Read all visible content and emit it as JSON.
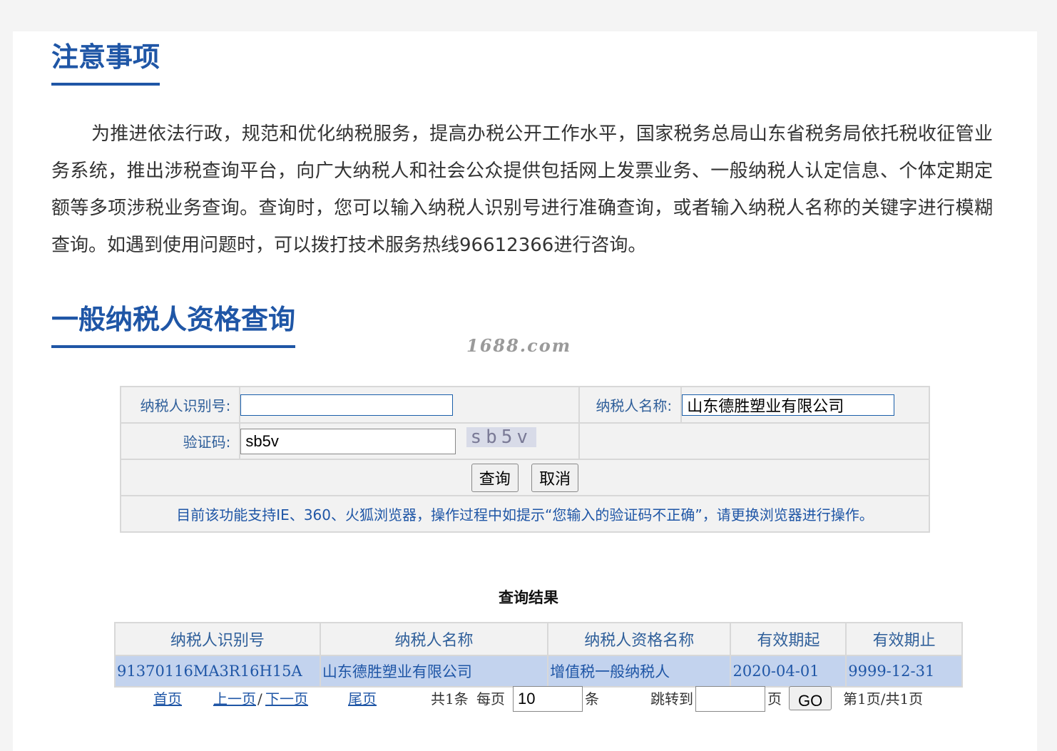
{
  "notice": {
    "title": "注意事项",
    "body": "为推进依法行政，规范和优化纳税服务，提高办税公开工作水平，国家税务总局山东省税务局依托税收征管业务系统，推出涉税查询平台，向广大纳税人和社会公众提供包括网上发票业务、一般纳税人认定信息、个体定期定额等多项涉税业务查询。查询时，您可以输入纳税人识别号进行准确查询，或者输入纳税人名称的关键字进行模糊查询。如遇到使用问题时，可以拨打技术服务热线96612366进行咨询。"
  },
  "query": {
    "title": "一般纳税人资格查询",
    "watermark": "1688.com",
    "taxpayer_id_label": "纳税人识别号:",
    "taxpayer_id_value": "",
    "taxpayer_name_label": "纳税人名称:",
    "taxpayer_name_value": "山东德胜塑业有限公司",
    "captcha_label": "验证码:",
    "captcha_value": "sb5v",
    "captcha_image_text": "sb5v",
    "search_button": "查询",
    "cancel_button": "取消",
    "hint": "目前该功能支持IE、360、火狐浏览器，操作过程中如提示“您输入的验证码不正确”，请更换浏览器进行操作。"
  },
  "results": {
    "title": "查询结果",
    "columns": [
      "纳税人识别号",
      "纳税人名称",
      "纳税人资格名称",
      "有效期起",
      "有效期止"
    ],
    "rows": [
      [
        "91370116MA3R16H15A",
        "山东德胜塑业有限公司",
        "增值税一般纳税人",
        "2020-04-01",
        "9999-12-31"
      ]
    ]
  },
  "pager": {
    "first": "首页",
    "prev": "上一页",
    "separator": "/",
    "next": "下一页",
    "last": "尾页",
    "total": "共1条",
    "per_page_label": "每页",
    "per_page_value": "10",
    "per_page_unit": "条",
    "jump_label": "跳转到",
    "jump_value": "",
    "page_unit": "页",
    "go_button": "GO",
    "status": "第1页/共1页"
  }
}
